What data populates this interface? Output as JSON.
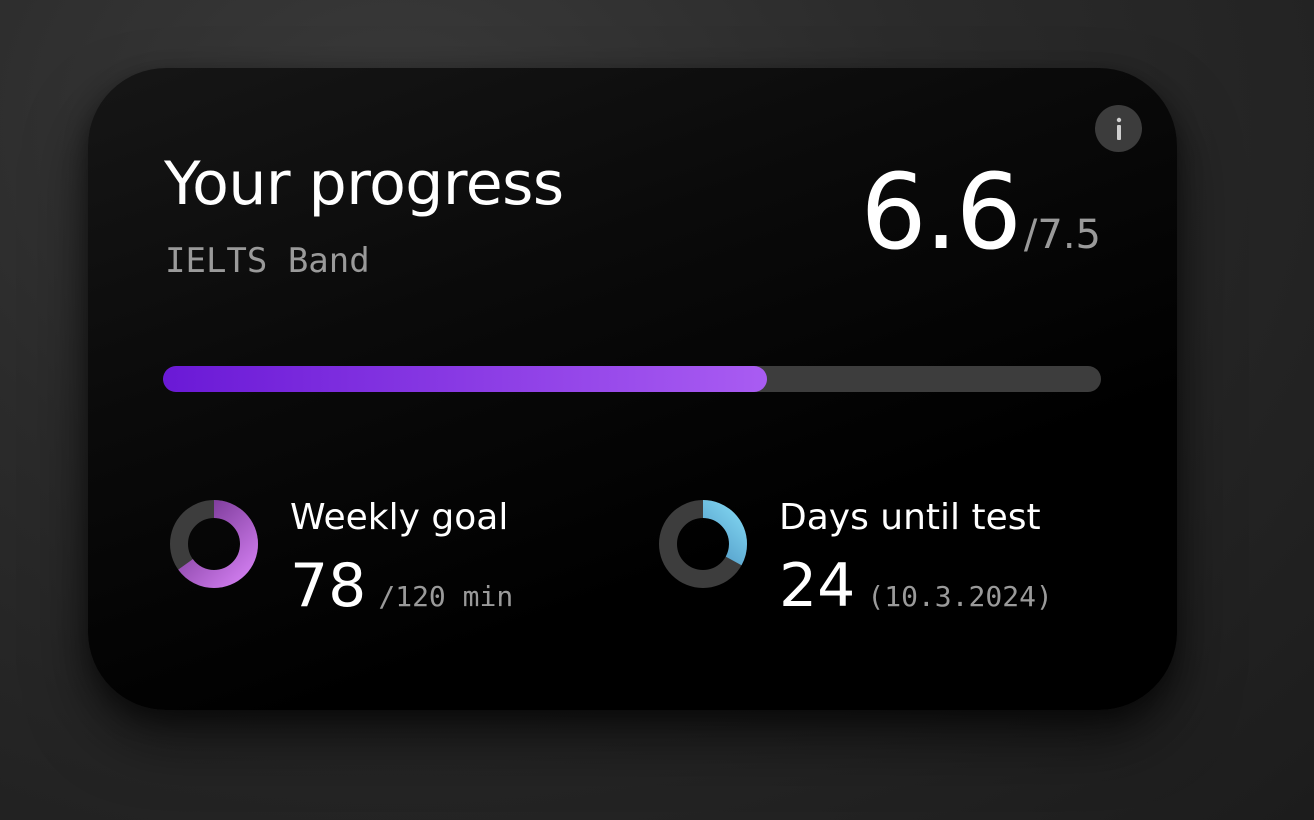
{
  "card": {
    "title": "Your progress",
    "subtitle": "IELTS Band",
    "info_icon": "info-icon",
    "score": {
      "value": "6.6",
      "max_label": "/7.5"
    },
    "progress": {
      "fraction": 0.644,
      "track_color": "#3d3d3d",
      "fill_colors": [
        "#6a19d6",
        "#a95cf2"
      ]
    }
  },
  "stats": {
    "weekly_goal": {
      "label": "Weekly goal",
      "value": "78",
      "unit": "/120 min",
      "ring_fraction": 0.65,
      "ring_color": "#d27ef0",
      "ring_color_start": "#6d2f8a"
    },
    "days_until_test": {
      "label": "Days until test",
      "value": "24",
      "unit": "(10.3.2024)",
      "ring_fraction": 0.33,
      "ring_color": "#7fd3ef",
      "ring_color_start": "#2e6fa8"
    }
  },
  "colors": {
    "background": "#2b2b2b",
    "card": "#000000",
    "text_primary": "#ffffff",
    "text_secondary": "#9a9a9a"
  }
}
